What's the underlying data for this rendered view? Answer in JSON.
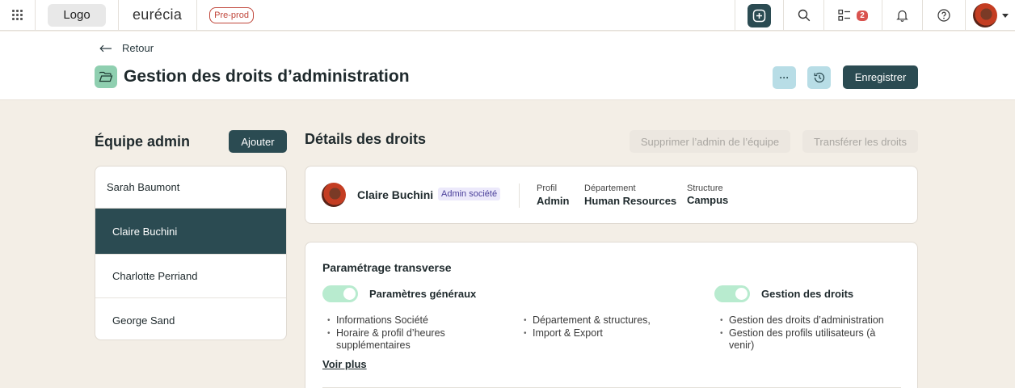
{
  "topbar": {
    "logo_label": "Logo",
    "brand": "eurécia",
    "environment": "Pre-prod",
    "tasks_count": "2"
  },
  "header": {
    "back_label": "Retour",
    "title": "Gestion des droits d’administration",
    "more_label": "···",
    "save_label": "Enregistrer"
  },
  "team": {
    "title": "Équipe admin",
    "add_label": "Ajouter",
    "members": [
      "Sarah Baumont",
      "Claire Buchini",
      "Charlotte Perriand",
      "George Sand"
    ],
    "selected": "Claire Buchini"
  },
  "details": {
    "title": "Détails des droits",
    "remove_label": "Supprimer l’admin de l’équipe",
    "transfer_label": "Transférer les droits",
    "user": {
      "name": "Claire Buchini",
      "role_badge": "Admin société",
      "profile_label": "Profil",
      "profile_value": "Admin",
      "department_label": "Département",
      "department_value": "Human Resources",
      "structure_label": "Structure",
      "structure_value": "Campus"
    }
  },
  "settings": {
    "title": "Paramétrage transverse",
    "group1": {
      "label": "Paramètres généraux",
      "enabled": true,
      "col1": [
        "Informations Société",
        "Horaire & profil d’heures supplémentaires"
      ],
      "col2": [
        "Département & structures,",
        "Import & Export"
      ]
    },
    "group2": {
      "label": "Gestion des droits",
      "enabled": true,
      "items": [
        "Gestion des droits d’administration",
        "Gestion des profils utilisateurs (à venir)"
      ]
    },
    "see_more": "Voir plus"
  },
  "colors": {
    "primary": "#2b4b52",
    "accent_light": "#b8dde6",
    "toggle_on": "#b8ebcf",
    "badge_red": "#d9534f",
    "page_bg": "#f3eee6"
  }
}
